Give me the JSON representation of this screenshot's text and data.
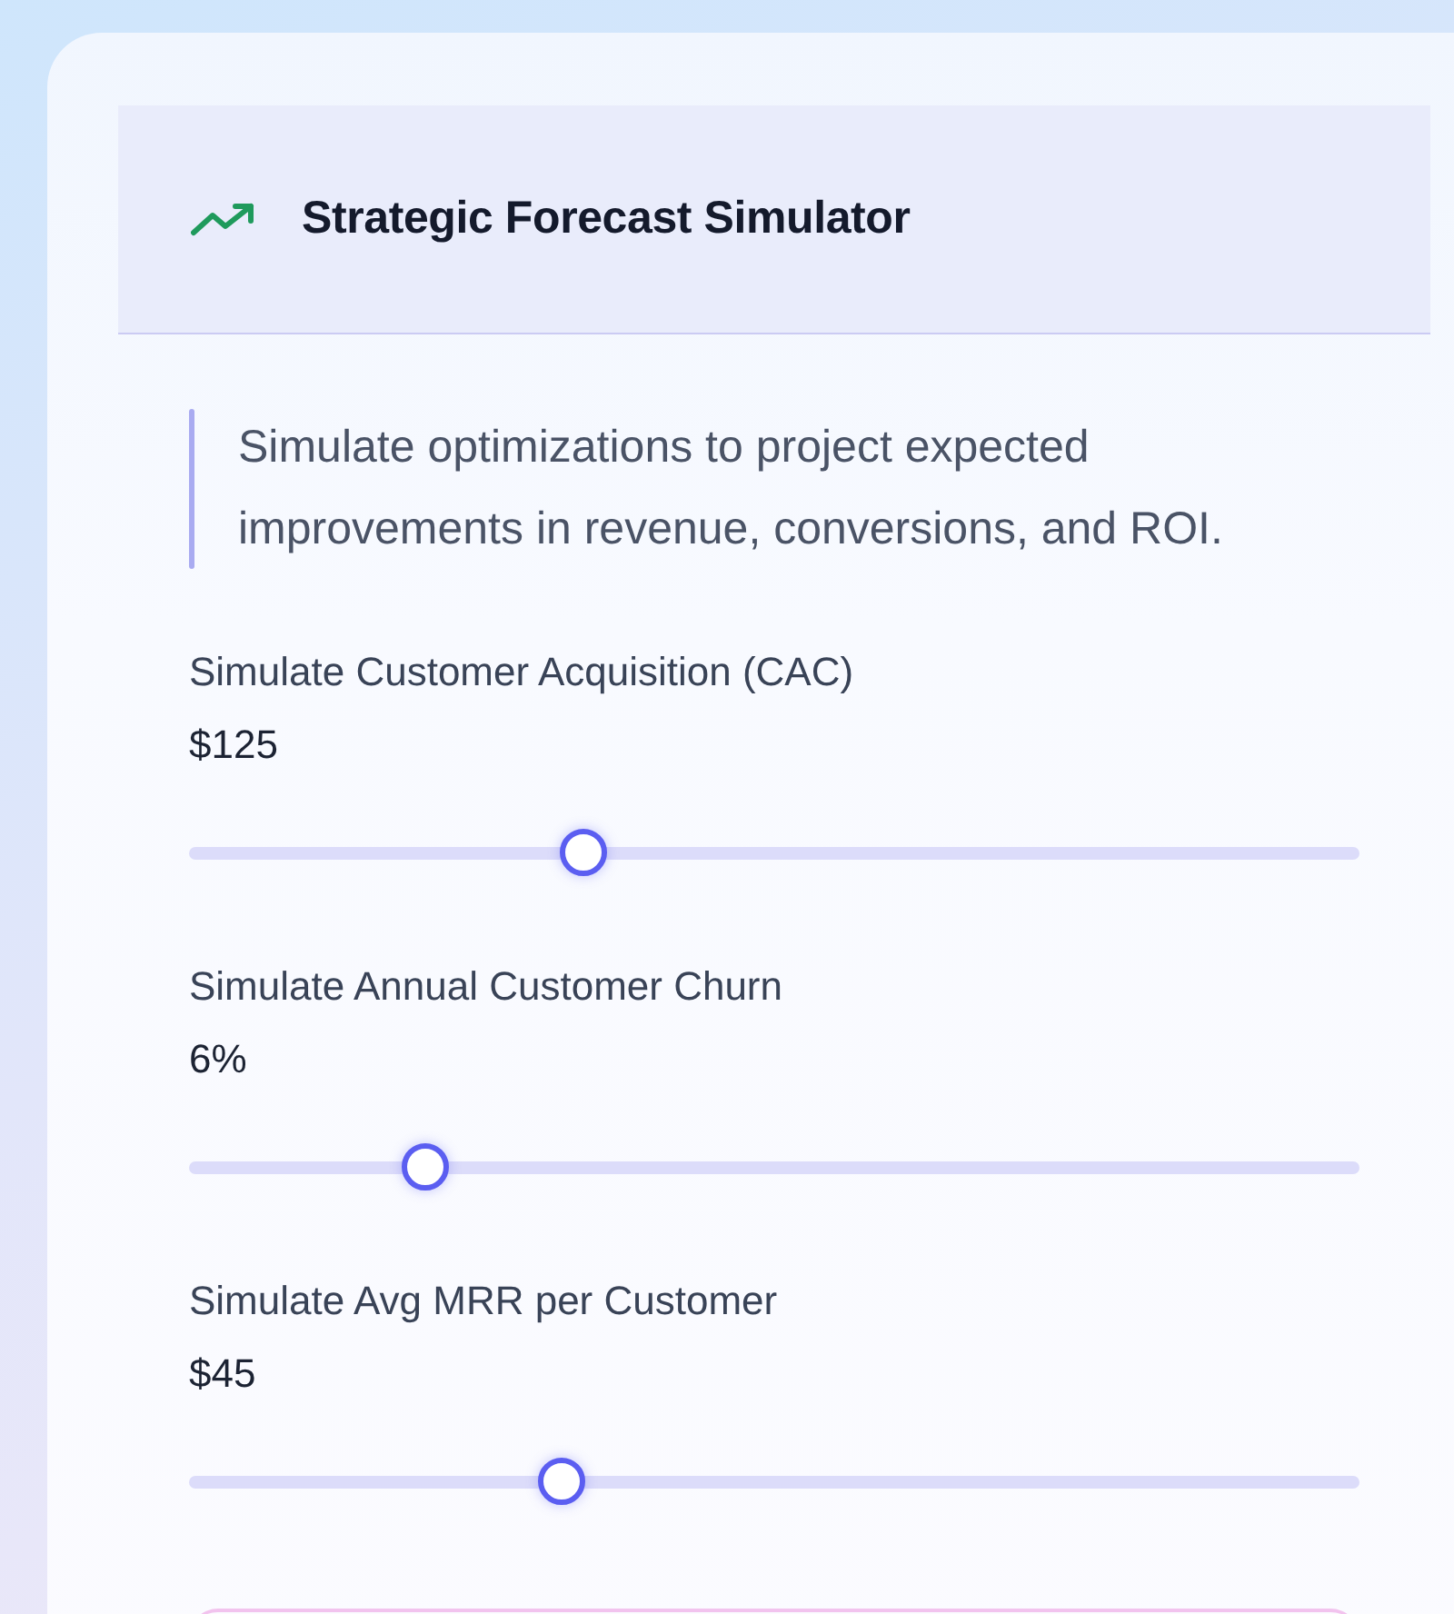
{
  "header": {
    "title": "Strategic Forecast Simulator"
  },
  "description": "Simulate optimizations to project expected improvements in revenue, conversions, and ROI.",
  "sliders": [
    {
      "label": "Simulate Customer Acquisition (CAC)",
      "value": "$125",
      "level": 0.33
    },
    {
      "label": "Simulate Annual Customer Churn",
      "value": "6%",
      "level": 0.19
    },
    {
      "label": "Simulate Avg MRR per Customer",
      "value": "$45",
      "level": 0.31
    }
  ]
}
